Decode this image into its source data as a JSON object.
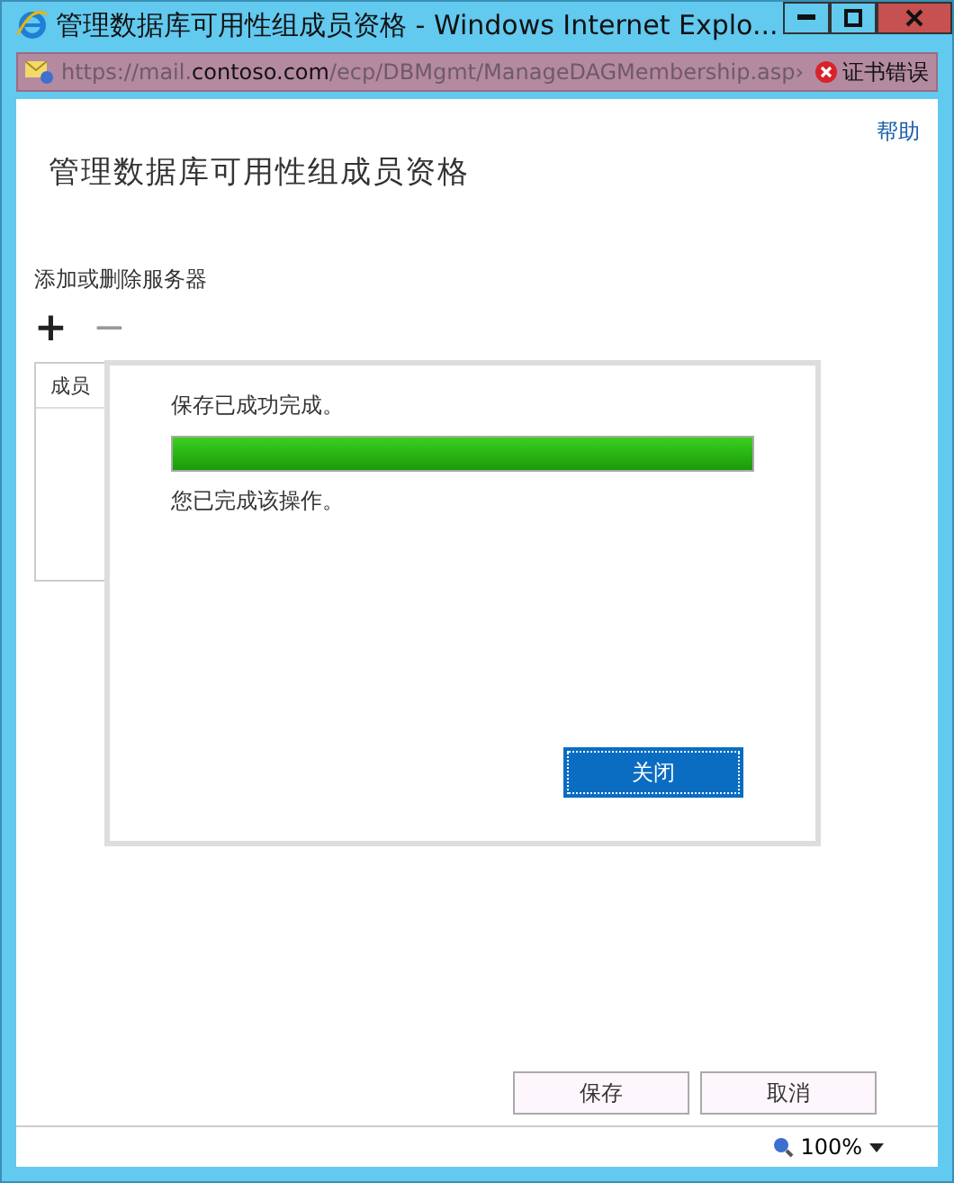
{
  "window": {
    "title": "管理数据库可用性组成员资格 - Windows Internet Explo..."
  },
  "address_bar": {
    "url_prefix": "https://mail.",
    "url_domain": "contoso.com",
    "url_path": "/ecp/DBMgmt/ManageDAGMembership.asp›",
    "certificate_error": "证书错误"
  },
  "page": {
    "help_link": "帮助",
    "heading": "管理数据库可用性组成员资格",
    "section_label": "添加或删除服务器",
    "add_button": "+",
    "remove_button": "−",
    "table": {
      "columns": [
        "成员"
      ]
    },
    "buttons": [
      "保存",
      "取消"
    ]
  },
  "dialog": {
    "message": "保存已成功完成。",
    "progress": {
      "level": 1
    },
    "detail": "您已完成该操作。",
    "button": "关闭"
  },
  "status_bar": {
    "zoom": "100%"
  }
}
